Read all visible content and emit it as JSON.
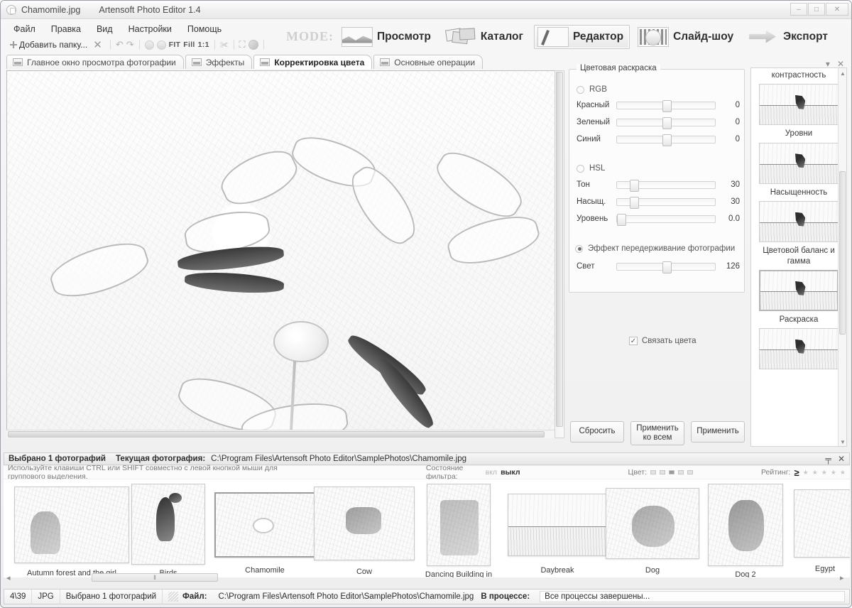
{
  "titlebar": {
    "filename": "Chamomile.jpg",
    "appname": "Artensoft Photo Editor 1.4",
    "minimize": "–",
    "maximize": "□",
    "close": "✕"
  },
  "menubar": {
    "items": [
      {
        "label": "Файл"
      },
      {
        "label": "Правка"
      },
      {
        "label": "Вид"
      },
      {
        "label": "Настройки"
      },
      {
        "label": "Помощь"
      }
    ]
  },
  "toolbar": {
    "add_folder": "Добавить папку...",
    "remove": "✕",
    "rotate_left": "↶",
    "rotate_right": "↷",
    "zoom_out": "−",
    "zoom_in": "+",
    "fit": "FIT",
    "fill": "Fill",
    "one_to_one": "1:1",
    "crop": "✀",
    "fullscreen": "⛶",
    "refresh": "◔"
  },
  "modebar": {
    "label": "MODE:",
    "modes": [
      {
        "label": "Просмотр",
        "icon": "preview-icon",
        "active": false
      },
      {
        "label": "Каталог",
        "icon": "catalog-icon",
        "active": false
      },
      {
        "label": "Редактор",
        "icon": "editor-icon",
        "active": true
      },
      {
        "label": "Слайд-шоу",
        "icon": "slideshow-icon",
        "active": false
      },
      {
        "label": "Экспорт",
        "icon": "export-icon",
        "active": false
      }
    ]
  },
  "tabs": {
    "items": [
      {
        "label": "Главное окно просмотра фотографии",
        "active": false
      },
      {
        "label": "Эффекты",
        "active": false
      },
      {
        "label": "Корректировка цвета",
        "active": true
      },
      {
        "label": "Основные операции",
        "active": false
      }
    ],
    "dropdown": "▾",
    "close": "✕"
  },
  "settings": {
    "legend": "Цветовая раскраска",
    "rgb_radio": {
      "label": "RGB",
      "selected": false
    },
    "rgb_sliders": [
      {
        "name": "Красный",
        "value": "0",
        "pos": 50
      },
      {
        "name": "Зеленый",
        "value": "0",
        "pos": 50
      },
      {
        "name": "Синий",
        "value": "0",
        "pos": 50
      }
    ],
    "hsl_radio": {
      "label": "HSL",
      "selected": false
    },
    "hsl_sliders": [
      {
        "name": "Тон",
        "value": "30",
        "pos": 15
      },
      {
        "name": "Насыщ.",
        "value": "30",
        "pos": 15
      },
      {
        "name": "Уровень",
        "value": "0.0",
        "pos": 1
      }
    ],
    "overexpose_radio": {
      "label": "Эффект передерживание фотографии",
      "selected": true
    },
    "light_slider": {
      "name": "Свет",
      "value": "126",
      "pos": 50
    },
    "link_colors": {
      "label": "Связать цвета",
      "checked": true,
      "mark": "✓"
    },
    "buttons": {
      "reset": "Сбросить",
      "apply_all_line1": "Применить",
      "apply_all_line2": "ко всем",
      "apply": "Применить"
    }
  },
  "effects_list": {
    "top_caption": "контрастность",
    "items": [
      {
        "caption": "Уровни",
        "selected": false
      },
      {
        "caption": "Насыщенность",
        "selected": false
      },
      {
        "caption": "Цветовой баланс и гамма",
        "selected": false
      },
      {
        "caption": "Раскраска",
        "selected": true
      },
      {
        "caption": "",
        "selected": false
      }
    ],
    "scroll_up": "▲",
    "scroll_down": "▼"
  },
  "dock": {
    "selected_count": "Выбрано 1  фотографий",
    "current_label": "Текущая фотография:",
    "current_path": "C:\\Program Files\\Artensoft Photo Editor\\SamplePhotos\\Chamomile.jpg",
    "pin": "╤",
    "close": "✕",
    "hint": "Используйте клавиши CTRL или SHIFT совместно с левой кнопкой мыши для группового выделения.",
    "filter_label": "Состояние фильтра:",
    "filter_on": "вкл",
    "filter_off": "выкл",
    "color_label": "Цвет:",
    "rating_label": "Рейтинг:",
    "rating_value": "≥"
  },
  "filmstrip": {
    "items": [
      {
        "caption": "Autumn forest and the girl",
        "selected": false
      },
      {
        "caption": "Birds",
        "selected": false
      },
      {
        "caption": "Chamomile",
        "selected": true
      },
      {
        "caption": "Cow",
        "selected": false
      },
      {
        "caption": "Dancing Building in Prague",
        "selected": false
      },
      {
        "caption": "Daybreak",
        "selected": false
      },
      {
        "caption": "Dog",
        "selected": false
      },
      {
        "caption": "Dog 2",
        "selected": false
      },
      {
        "caption": "Egypt",
        "selected": false
      }
    ],
    "scroll_grip": "‖",
    "left_arrow": "◂",
    "right_arrow": "▸"
  },
  "statusbar": {
    "index": "4\\39",
    "format": "JPG",
    "selected": "Выбрано 1 фотографий",
    "file_label": "Файл:",
    "file_path": "C:\\Program Files\\Artensoft Photo Editor\\SamplePhotos\\Chamomile.jpg",
    "process_label": "В процессе:",
    "process_text": "Все процессы завершены..."
  }
}
